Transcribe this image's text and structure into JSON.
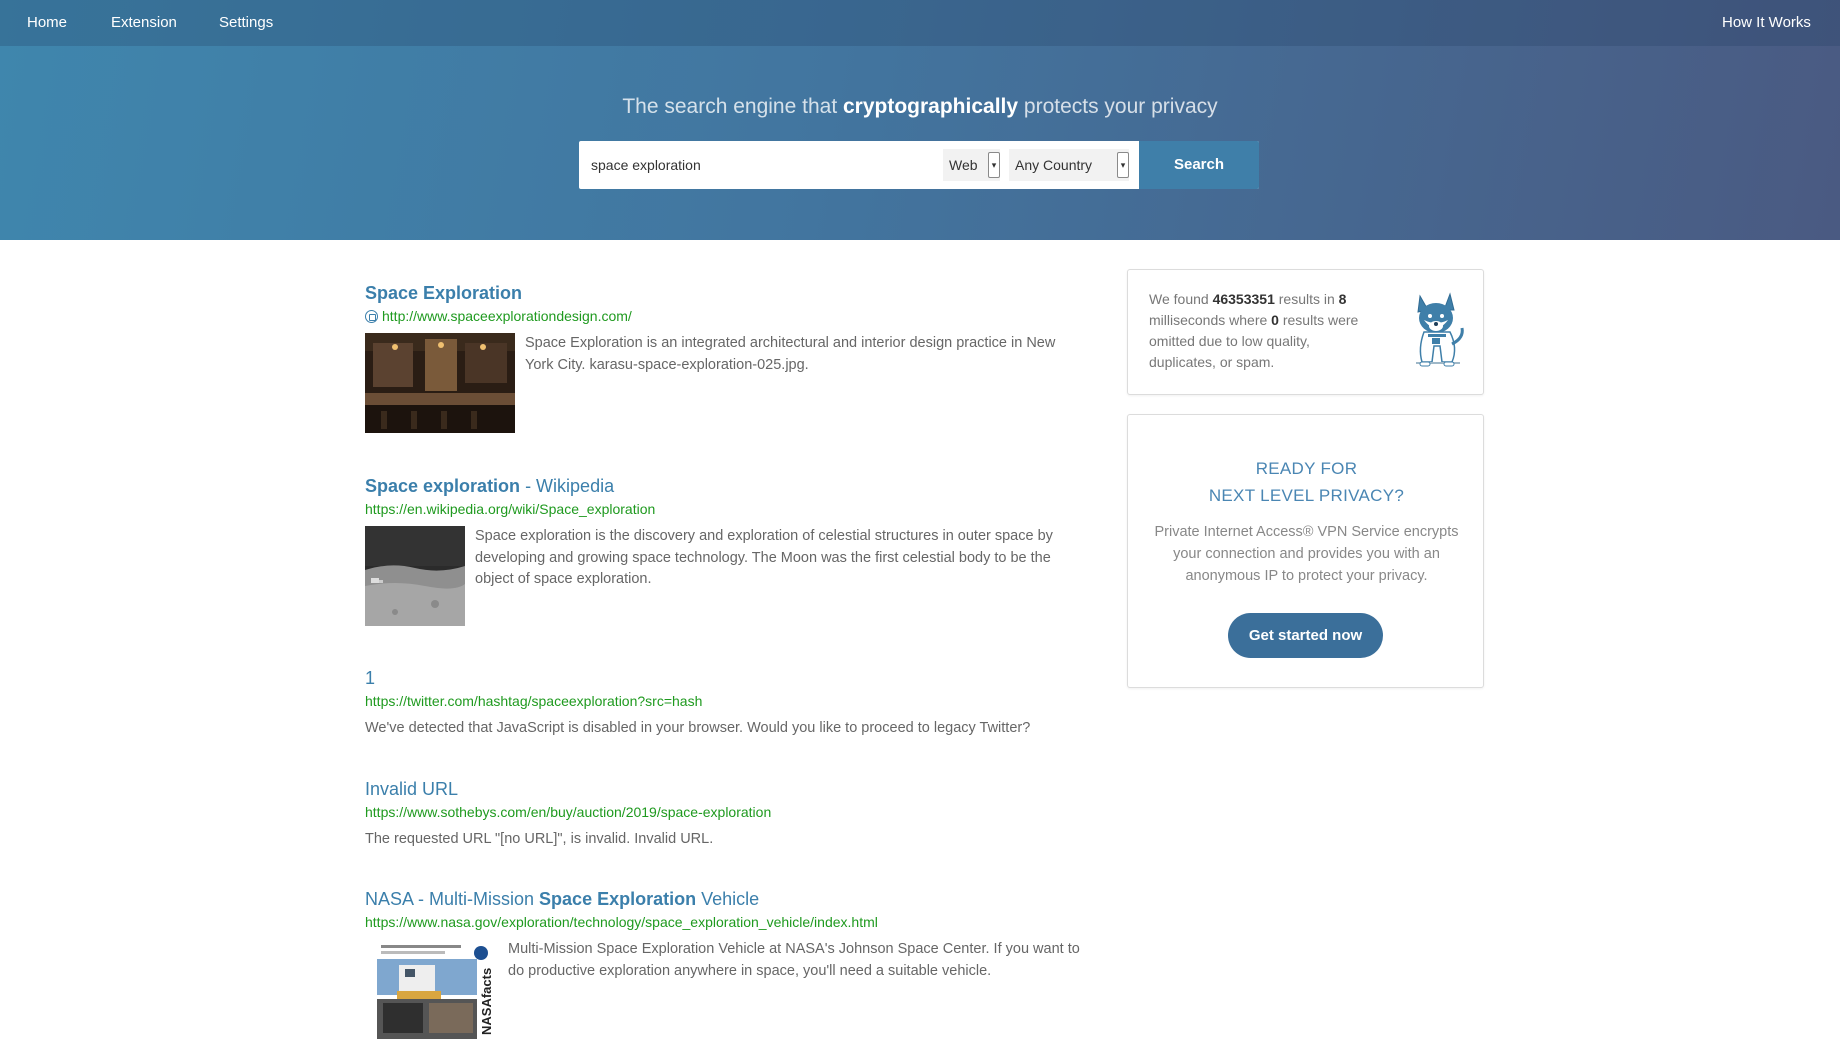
{
  "nav": {
    "home": "Home",
    "extension": "Extension",
    "settings": "Settings",
    "how_it_works": "How It Works"
  },
  "hero": {
    "tagline_pre": "The search engine that ",
    "tagline_bold": "cryptographically",
    "tagline_post": " protects your privacy"
  },
  "search": {
    "query": "space exploration",
    "type_selected": "Web",
    "country_selected": "Any Country",
    "button_label": "Search"
  },
  "results": [
    {
      "title_parts": [
        {
          "text": "Space Exploration",
          "bold": true
        }
      ],
      "url": "http://www.spaceexplorationdesign.com/",
      "description": "Space Exploration is an integrated architectural and interior design practice in New York City. karasu-space-exploration-025.jpg.",
      "thumbnail_icon": "interior-photo-thumbnail"
    },
    {
      "title_parts": [
        {
          "text": "Space exploration",
          "bold": true
        },
        {
          "text": " - Wikipedia",
          "bold": false
        }
      ],
      "url": "https://en.wikipedia.org/wiki/Space_exploration",
      "description": "Space exploration is the discovery and exploration of celestial structures in outer space by developing and growing space technology. The Moon was the first celestial body to be the object of space exploration.",
      "thumbnail_icon": "moon-surface-thumbnail"
    },
    {
      "title_parts": [
        {
          "text": "1",
          "bold": false
        }
      ],
      "url": "https://twitter.com/hashtag/spaceexploration?src=hash",
      "description": "We've detected that JavaScript is disabled in your browser. Would you like to proceed to legacy Twitter?"
    },
    {
      "title_parts": [
        {
          "text": "Invalid URL",
          "bold": false
        }
      ],
      "url": "https://www.sothebys.com/en/buy/auction/2019/space-exploration",
      "description": "The requested URL \"[no URL]\", is invalid. Invalid URL."
    },
    {
      "title_parts": [
        {
          "text": "NASA - Multi-Mission ",
          "bold": false
        },
        {
          "text": "Space Exploration",
          "bold": true
        },
        {
          "text": " Vehicle",
          "bold": false
        }
      ],
      "url": "https://www.nasa.gov/exploration/technology/space_exploration_vehicle/index.html",
      "description": "Multi-Mission Space Exploration Vehicle at NASA's Johnson Space Center. If you want to do productive exploration anywhere in space, you'll need a suitable vehicle.",
      "thumbnail_icon": "nasa-facts-thumbnail",
      "thumbnail_text": "NASAfacts"
    }
  ],
  "stats": {
    "t1": "We found ",
    "count": "46353351",
    "t2": " results in ",
    "ms": "8",
    "t3": " milliseconds where ",
    "omitted": "0",
    "t4": " results were omitted due to low quality, duplicates, or spam."
  },
  "promo": {
    "heading_line1": "READY FOR",
    "heading_line2": "NEXT LEVEL PRIVACY?",
    "text": "Private Internet Access® VPN Service encrypts your connection and provides you with an anonymous IP to protect your privacy.",
    "button_label": "Get started now"
  },
  "colors": {
    "link_blue": "#3b7fab",
    "url_green": "#1f9a1f",
    "button_blue": "#3f7fa9"
  }
}
